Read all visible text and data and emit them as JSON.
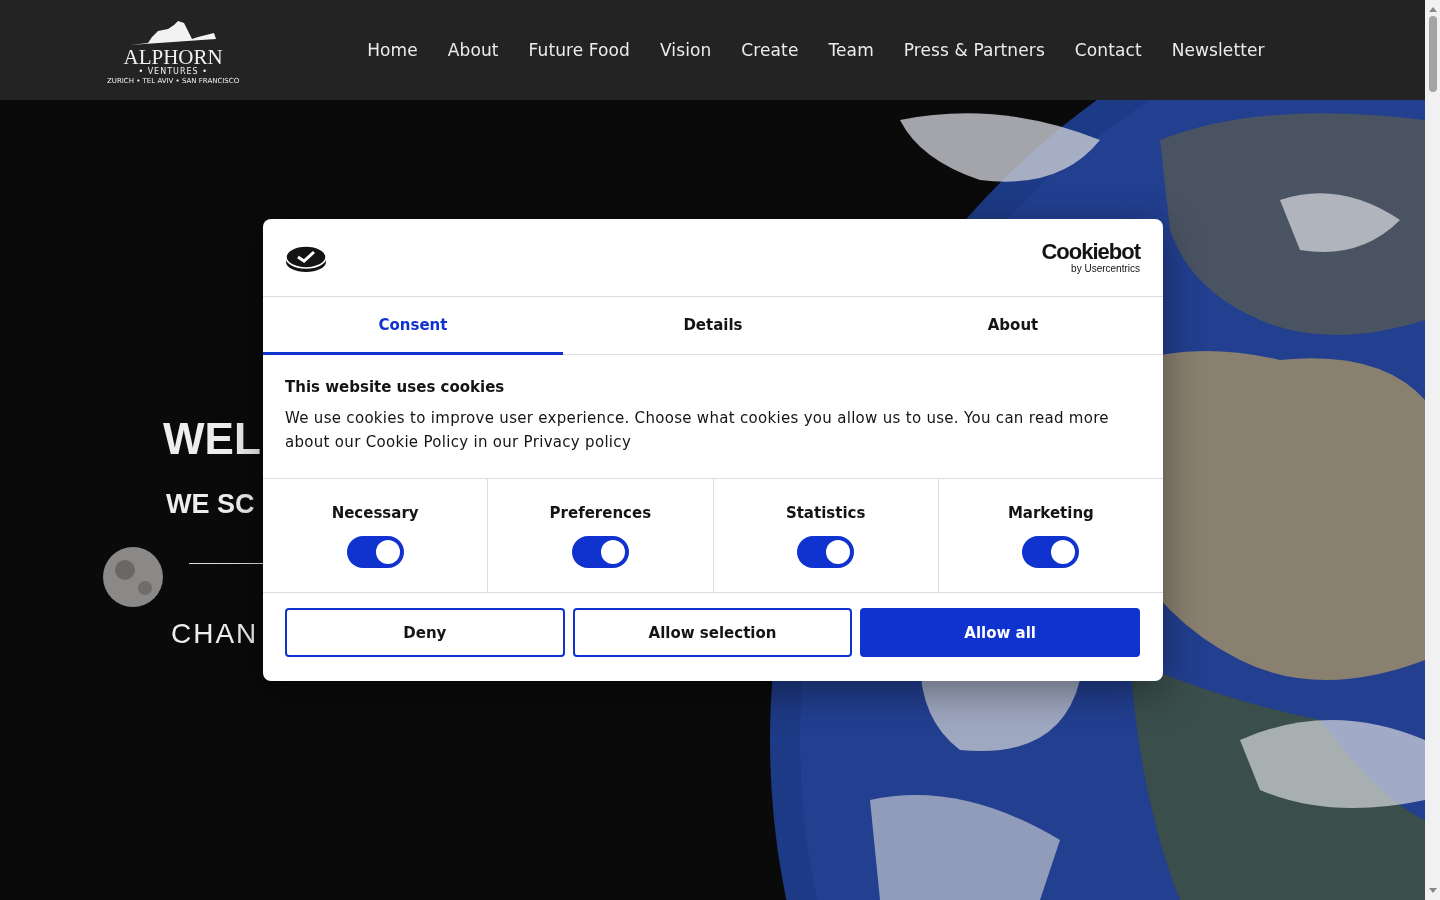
{
  "nav": {
    "logo": {
      "name": "ALPHORN",
      "subtitle": "• VENTURES •",
      "cities": "ZURICH • TEL AVIV • SAN FRANCISCO"
    },
    "links": [
      {
        "label": "Home"
      },
      {
        "label": "About"
      },
      {
        "label": "Future Food"
      },
      {
        "label": "Vision"
      },
      {
        "label": "Create"
      },
      {
        "label": "Team"
      },
      {
        "label": "Press & Partners"
      },
      {
        "label": "Contact"
      },
      {
        "label": "Newsletter"
      }
    ]
  },
  "hero": {
    "heading": "WEL",
    "subheading": "WE SC",
    "tagline": "CHAN"
  },
  "cookie_dialog": {
    "brand": "Cookiebot",
    "brand_by": "by Usercentrics",
    "tabs": [
      {
        "label": "Consent",
        "selected": true
      },
      {
        "label": "Details",
        "selected": false
      },
      {
        "label": "About",
        "selected": false
      }
    ],
    "title": "This website uses cookies",
    "text": "We use cookies to improve user experience. Choose what cookies you allow us to use. You can read more about our Cookie Policy in our Privacy policy",
    "categories": [
      {
        "label": "Necessary",
        "on": true
      },
      {
        "label": "Preferences",
        "on": true
      },
      {
        "label": "Statistics",
        "on": true
      },
      {
        "label": "Marketing",
        "on": true
      }
    ],
    "buttons": [
      {
        "label": "Deny",
        "kind": "outline"
      },
      {
        "label": "Allow selection",
        "kind": "outline"
      },
      {
        "label": "Allow all",
        "kind": "primary"
      }
    ]
  }
}
